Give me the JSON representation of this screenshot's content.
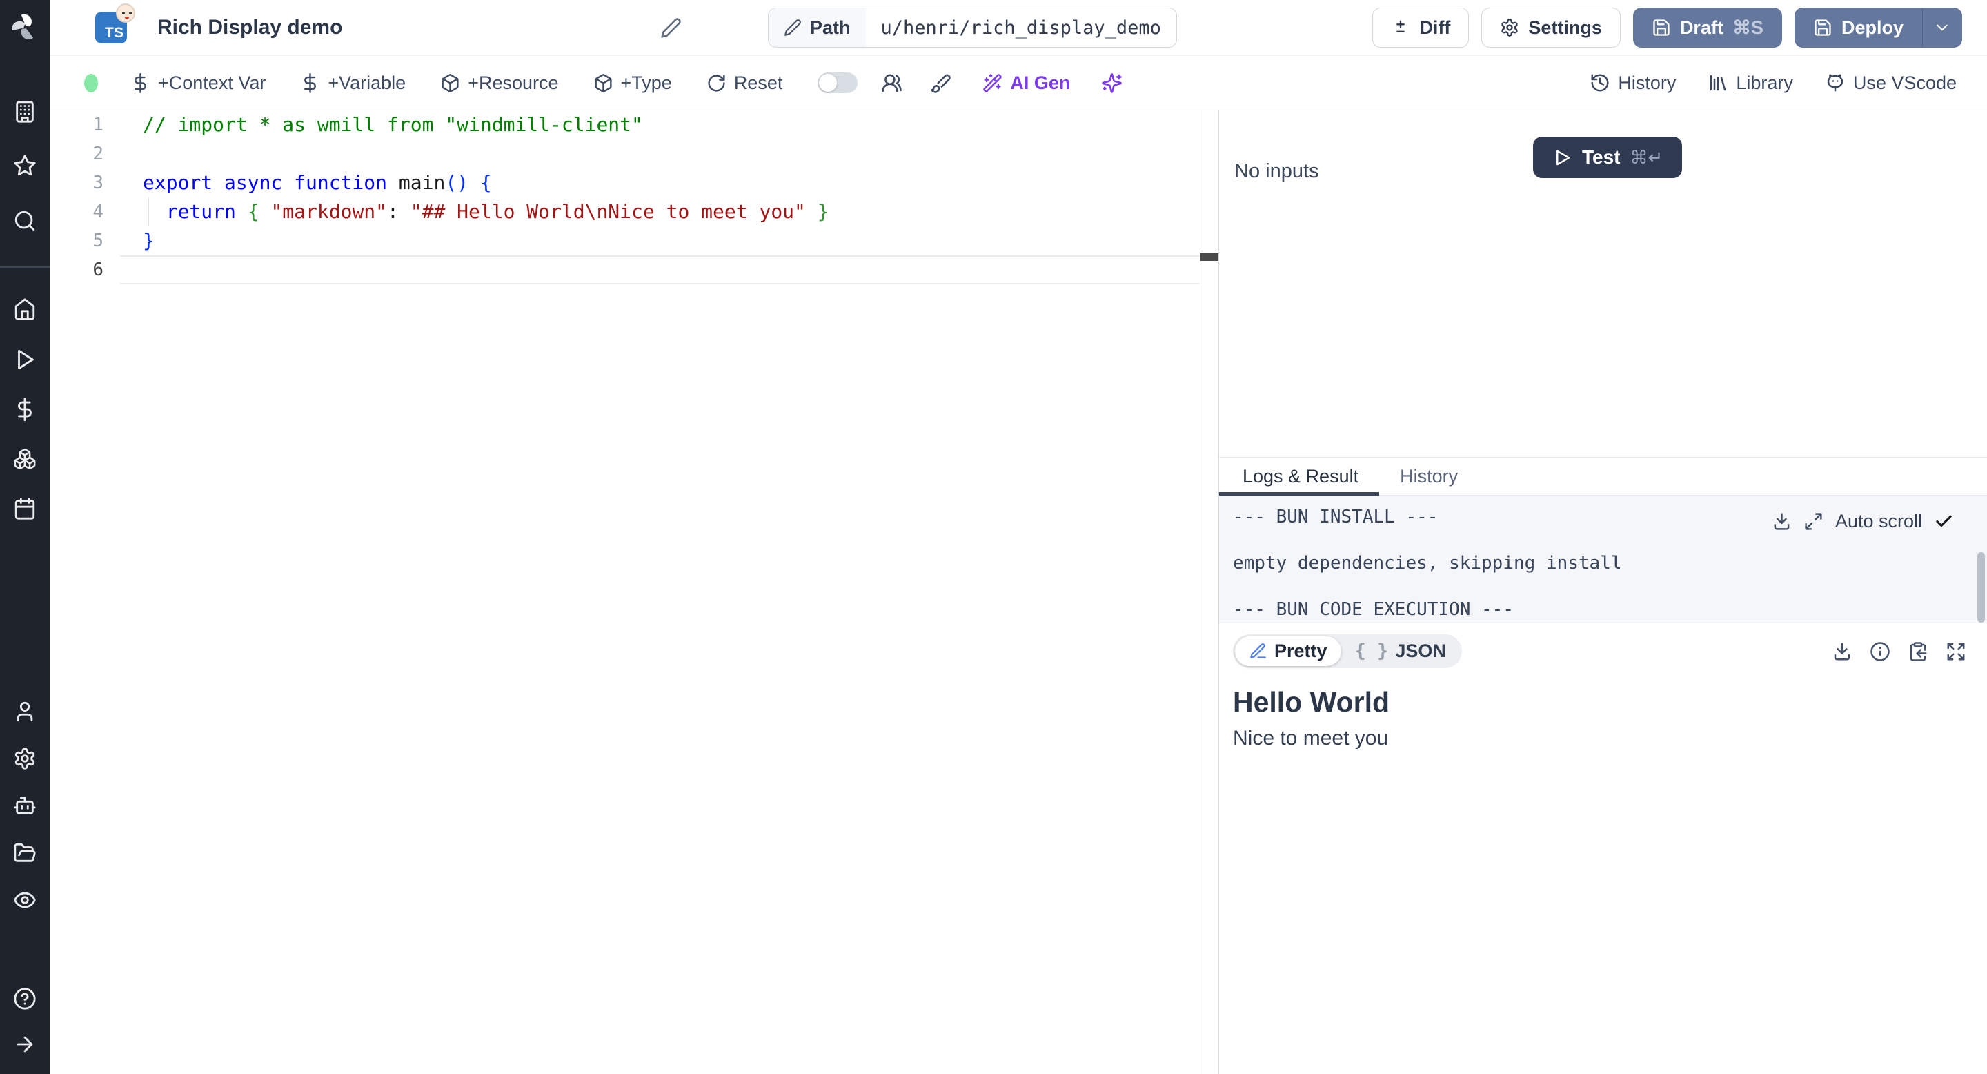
{
  "header": {
    "title": "Rich Display demo",
    "language_badge": "TS",
    "path_label": "Path",
    "path_value": "u/henri/rich_display_demo",
    "diff_label": "Diff",
    "settings_label": "Settings",
    "draft_label": "Draft",
    "draft_shortcut": "⌘S",
    "deploy_label": "Deploy"
  },
  "toolbar": {
    "add_context_var": "+Context Var",
    "add_variable": "+Variable",
    "add_resource": "+Resource",
    "add_type": "+Type",
    "reset": "Reset",
    "ai_gen": "AI Gen",
    "history": "History",
    "library": "Library",
    "use_vscode": "Use VScode"
  },
  "sidebar": {
    "icons": [
      "windmill-logo",
      "building",
      "star",
      "search",
      "home",
      "play",
      "dollar-sign",
      "boxes",
      "calendar",
      "user",
      "settings-gear",
      "bot",
      "folder-open",
      "eye",
      "help-circle",
      "arrow-right"
    ]
  },
  "editor": {
    "line_numbers": [
      "1",
      "2",
      "3",
      "4",
      "5",
      "6"
    ],
    "code": {
      "l1_comment": "// import * as wmill from \"windmill-client\"",
      "l3_keywords": "export async function ",
      "l3_name": "main",
      "l3_tail": "() {",
      "l4_keyword": "  return",
      "l4_sp1": " ",
      "l4_open_brace": "{",
      "l4_sp2": " ",
      "l4_key": "\"markdown\"",
      "l4_colon": ":",
      "l4_sp3": " ",
      "l4_string": "\"## Hello World\\nNice to meet you\"",
      "l4_sp4": " ",
      "l4_close_brace": "}",
      "l5_brace": "}"
    },
    "colors": {
      "comment": "#008000",
      "keyword": "#0000ff",
      "string": "#a31515",
      "bracket_outer": "#0431fa",
      "bracket_inner": "#319331"
    }
  },
  "run_panel": {
    "test_label": "Test",
    "test_shortcut": "⌘↵",
    "no_inputs": "No inputs"
  },
  "output_panel": {
    "tabs": [
      {
        "label": "Logs & Result",
        "active": true
      },
      {
        "label": "History",
        "active": false
      }
    ],
    "logs": [
      "--- BUN INSTALL ---",
      "empty dependencies, skipping install",
      "--- BUN CODE EXECUTION ---"
    ],
    "auto_scroll_label": "Auto scroll",
    "result_view_toggle": {
      "pretty": "Pretty",
      "json_braces": "{ }",
      "json": "JSON",
      "selected": "Pretty"
    },
    "result": {
      "heading": "Hello World",
      "body": "Nice to meet you"
    }
  },
  "theme": {
    "accent_button": "#64789e",
    "dark_button": "#2f3a51",
    "ai_accent": "#7c3aed",
    "status_dot": "#86e8a5"
  }
}
